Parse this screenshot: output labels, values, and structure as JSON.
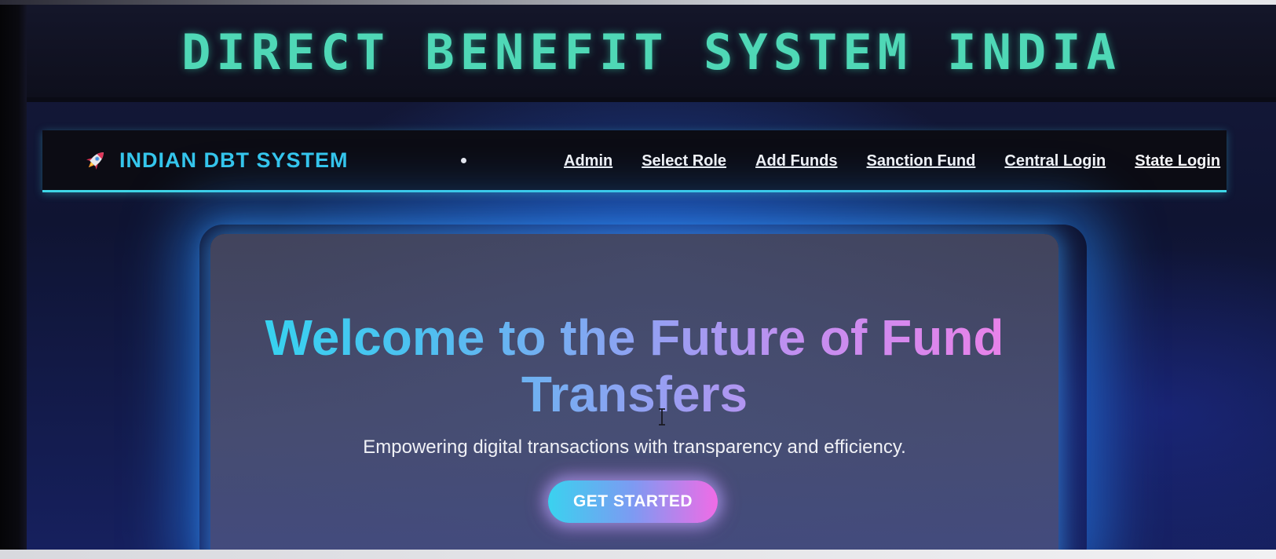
{
  "banner": {
    "title": "DIRECT BENEFIT SYSTEM INDIA"
  },
  "navbar": {
    "brand_icon": "rocket-icon",
    "brand_text": "INDIAN DBT SYSTEM",
    "links": [
      {
        "label": "Admin"
      },
      {
        "label": "Select Role"
      },
      {
        "label": "Add Funds"
      },
      {
        "label": "Sanction Fund"
      },
      {
        "label": "Central Login"
      },
      {
        "label": "State Login"
      }
    ]
  },
  "hero": {
    "title": "Welcome to the Future of Fund Transfers",
    "subtitle": "Empowering digital transactions with transparency and efficiency.",
    "cta_label": "GET STARTED"
  },
  "colors": {
    "banner_title": "#4fd8b6",
    "brand_text": "#35c6ec",
    "navbar_accent": "#3fd6e6",
    "gradient_start": "#2fd8ef",
    "gradient_end": "#f27fe8"
  }
}
